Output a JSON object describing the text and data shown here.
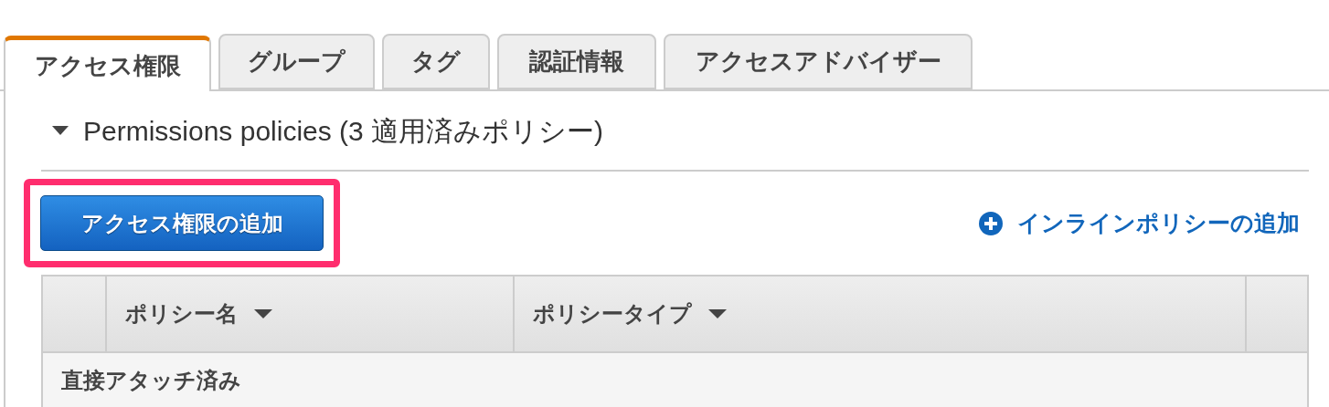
{
  "tabs": [
    {
      "label": "アクセス権限",
      "selected": true
    },
    {
      "label": "グループ",
      "selected": false
    },
    {
      "label": "タグ",
      "selected": false
    },
    {
      "label": "認証情報",
      "selected": false
    },
    {
      "label": "アクセスアドバイザー",
      "selected": false
    }
  ],
  "section": {
    "title": "Permissions policies (3 適用済みポリシー)",
    "expanded": true
  },
  "add_button": {
    "label": "アクセス権限の追加",
    "highlighted": true
  },
  "inline_link": {
    "label": "インラインポリシーの追加"
  },
  "table": {
    "columns": [
      {
        "label": "ポリシー名",
        "sortable": true
      },
      {
        "label": "ポリシータイプ",
        "sortable": true
      }
    ],
    "group_row": "直接アタッチ済み"
  }
}
